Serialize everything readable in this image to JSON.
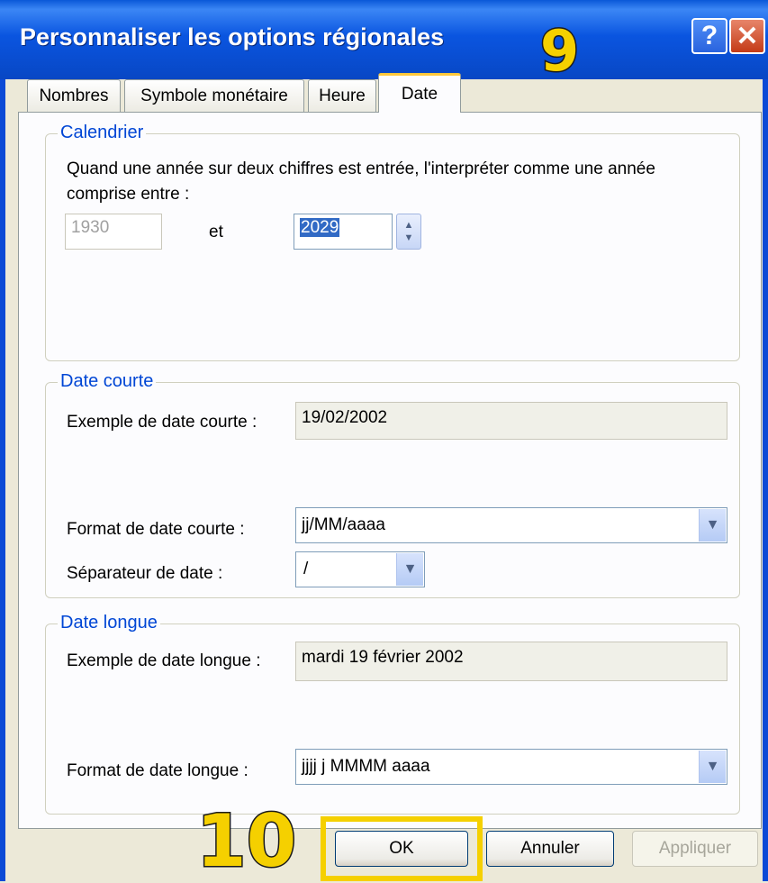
{
  "window": {
    "title": "Personnaliser les options régionales",
    "help_glyph": "?",
    "close_glyph": "✕"
  },
  "tabs": [
    {
      "label": "Nombres",
      "active": false
    },
    {
      "label": "Symbole monétaire",
      "active": false
    },
    {
      "label": "Heure",
      "active": false
    },
    {
      "label": "Date",
      "active": true
    }
  ],
  "calendar": {
    "legend": "Calendrier",
    "description": "Quand une année sur deux chiffres est entrée, l'interpréter comme une année comprise entre :",
    "from_value": "1930",
    "and_label": "et",
    "to_value": "2029"
  },
  "short_date": {
    "legend": "Date courte",
    "example_label": "Exemple de date courte :",
    "example_value": "19/02/2002",
    "format_label": "Format de date courte :",
    "format_value": "jj/MM/aaaa",
    "separator_label": "Séparateur de date :",
    "separator_value": "/"
  },
  "long_date": {
    "legend": "Date longue",
    "example_label": "Exemple de date longue :",
    "example_value": "mardi 19 février 2002",
    "format_label": "Format de date longue :",
    "format_value": "jjjj j MMMM aaaa"
  },
  "buttons": {
    "ok": "OK",
    "cancel": "Annuler",
    "apply": "Appliquer"
  },
  "annotations": {
    "step_a": "9",
    "step_b": "10"
  },
  "colors": {
    "accent": "#0046d5",
    "highlight": "#f5d000",
    "titlebar": "#0a55e0"
  },
  "icons": {
    "dropdown": "chevron-down-icon",
    "spin": "spin-arrows-icon",
    "help": "help-icon",
    "close": "close-icon"
  }
}
